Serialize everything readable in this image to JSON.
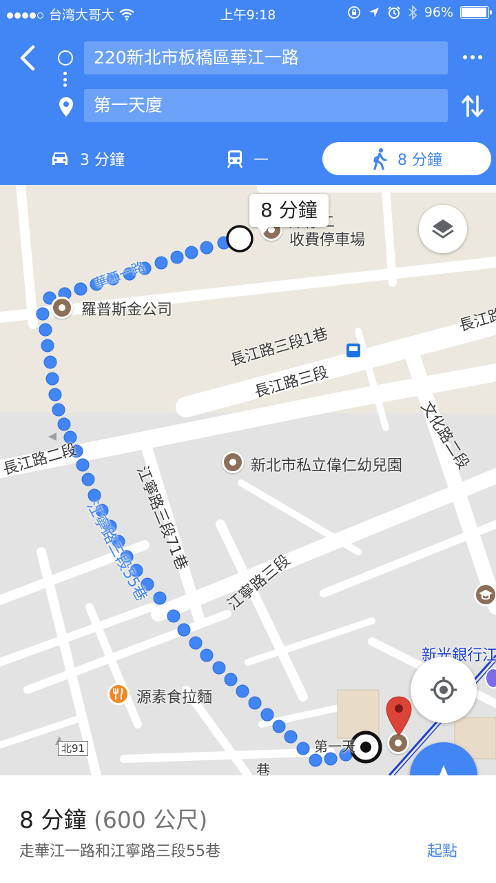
{
  "status_bar": {
    "carrier": "台湾大哥大",
    "time": "上午9:18",
    "battery": "96%",
    "battery_level": 0.96
  },
  "search": {
    "origin": "220新北市板橋區華江一路",
    "destination": "第一天廈"
  },
  "modes": {
    "car": "3 分鐘",
    "transit": "—",
    "walk": "8 分鐘"
  },
  "map": {
    "duration_bubble": "8 分鐘",
    "labels": {
      "parking": "岸停二\n收費停車場",
      "luopu": "羅普斯金公司",
      "changjiang3_lane1": "長江路三段1巷",
      "changjiang3": "長江路三段",
      "changjiang2": "長江路二段",
      "changjiang_right": "長江路",
      "wenhua2": "文化路二段",
      "kindergarten": "新北市私立偉仁幼兒園",
      "jiangning3_lane71": "江寧路三段71巷",
      "jiangning3": "江寧路三段",
      "jiangning3_lane55": "江寧路三段55巷",
      "huajiang1": "華江一路",
      "restaurant": "源素食拉麵",
      "bank": "新光銀行江",
      "destination_short": "第一天",
      "road_marker": "北91",
      "lane_stub": "巷"
    }
  },
  "bottom_sheet": {
    "duration": "8 分鐘",
    "distance": "(600 公尺)",
    "description": "走華江一路和江寧路三段55巷",
    "start_button": "起點"
  },
  "colors": {
    "header_blue": "#4285f4",
    "route_blue": "#4285f4",
    "poi_brown": "#8d6e58",
    "destination_red": "#db4437"
  },
  "icons": [
    "wifi-icon",
    "lock-rotation-icon",
    "location-arrow-icon",
    "alarm-icon",
    "bluetooth-icon",
    "back-arrow-icon",
    "more-icon",
    "swap-icon",
    "car-icon",
    "train-icon",
    "walk-icon",
    "layers-icon",
    "my-location-icon",
    "navigation-icon",
    "destination-pin-icon"
  ]
}
